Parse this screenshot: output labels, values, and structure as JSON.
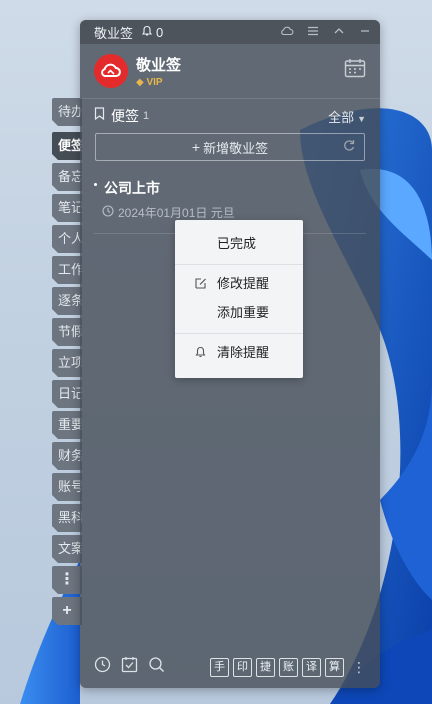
{
  "window": {
    "title": "敬业签",
    "notification_count": "0"
  },
  "header": {
    "app_name": "敬业签",
    "vip_badge": "VIP",
    "logo_color": "#e42b2b"
  },
  "side_tabs": [
    {
      "label": "待办",
      "active": false
    },
    {
      "label": "便签",
      "active": true
    },
    {
      "label": "备忘",
      "active": false
    },
    {
      "label": "笔记",
      "active": false
    },
    {
      "label": "个人",
      "active": false
    },
    {
      "label": "工作",
      "active": false
    },
    {
      "label": "逐条",
      "active": false
    },
    {
      "label": "节假",
      "active": false
    },
    {
      "label": "立项",
      "active": false
    },
    {
      "label": "日记",
      "active": false
    },
    {
      "label": "重要",
      "active": false
    },
    {
      "label": "财务",
      "active": false
    },
    {
      "label": "账号",
      "active": false
    },
    {
      "label": "黑科",
      "active": false
    },
    {
      "label": "文案",
      "active": false
    }
  ],
  "side_actions": {
    "more": "⋮",
    "add": "+"
  },
  "section": {
    "title": "便签",
    "count": "1",
    "filter": "全部"
  },
  "new_button": {
    "label": "新增敬业签"
  },
  "note": {
    "title": "公司上市",
    "date": "2024年01月01日 元旦"
  },
  "context_menu": {
    "items": [
      {
        "label": "已完成",
        "icon": ""
      },
      {
        "label": "修改提醒",
        "icon": "edit-icon"
      },
      {
        "label": "添加重要",
        "icon": ""
      },
      {
        "label": "清除提醒",
        "icon": "bell-clear-icon"
      }
    ]
  },
  "bottom_bar": {
    "shortcuts": [
      "手",
      "印",
      "捷",
      "账",
      "译",
      "算"
    ]
  }
}
